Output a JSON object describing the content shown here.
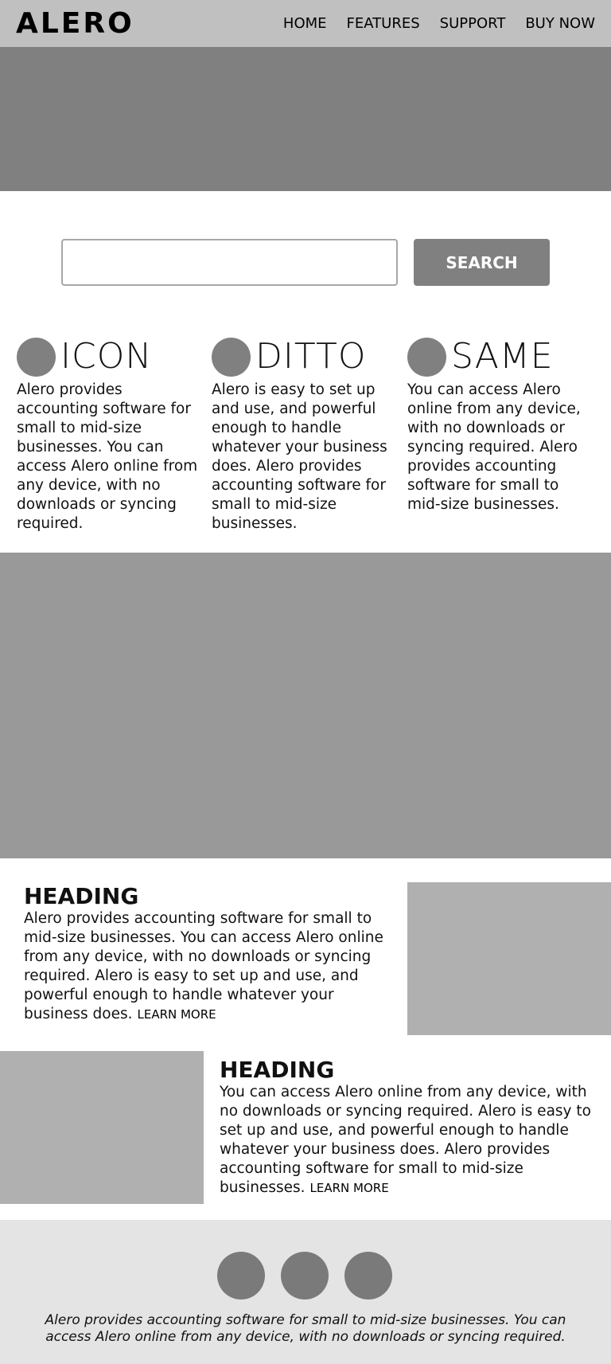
{
  "header": {
    "logo": "ALERO",
    "nav": [
      "HOME",
      "FEATURES",
      "SUPPORT",
      "BUY NOW"
    ]
  },
  "search": {
    "value": "",
    "placeholder": "",
    "button_label": "SEARCH"
  },
  "features": [
    {
      "title": "ICON",
      "text": "Alero provides accounting software for small to mid-size businesses. You can access Alero online from any device, with no downloads or syncing required."
    },
    {
      "title": "DITTO",
      "text": "Alero is easy to set up and use, and powerful enough to handle whatever your business does. Alero provides accounting software for small to mid-size businesses."
    },
    {
      "title": "SAME",
      "text": "You can access Alero online from any device, with no downloads or syncing required. Alero provides accounting software for small to mid-size businesses."
    }
  ],
  "sections": [
    {
      "heading": "HEADING",
      "text": "Alero provides accounting software for small to mid-size businesses. You can access Alero online from any device, with no downloads or syncing required. Alero is easy to set up and use, and powerful enough to handle whatever your business does.",
      "link": "LEARN MORE"
    },
    {
      "heading": "HEADING",
      "text": "You can access Alero online from any device, with no downloads or syncing required. Alero is easy to set up and use, and powerful enough to handle whatever your business does. Alero provides accounting software for small to mid-size businesses.",
      "link": "LEARN MORE"
    }
  ],
  "footer": {
    "text": "Alero provides accounting software for small to mid-size businesses. You can access Alero online from any device, with no downloads or syncing required."
  },
  "colors": {
    "header_bg": "#c0c0c0",
    "hero_bg": "#808080",
    "banner_bg": "#999999",
    "footer_bg": "#e4e4e4"
  }
}
